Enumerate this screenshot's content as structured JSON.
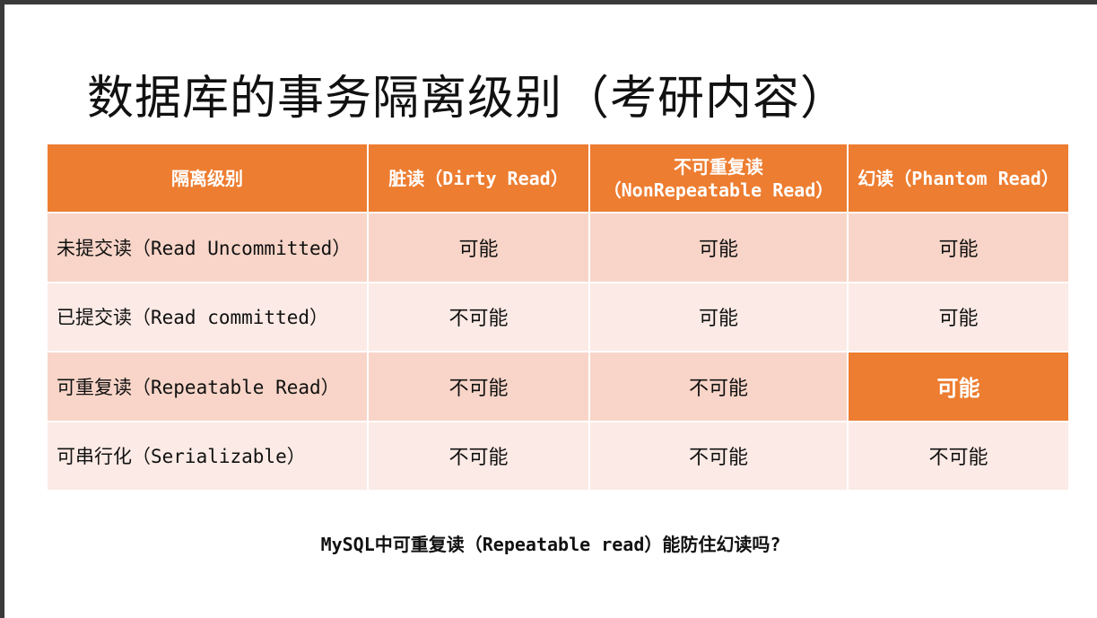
{
  "slide": {
    "title": "数据库的事务隔离级别（考研内容）",
    "footer": "MySQL中可重复读（Repeatable read）能防住幻读吗?"
  },
  "table": {
    "headers": [
      {
        "main": "隔离级别",
        "sub": ""
      },
      {
        "main": "脏读",
        "sub": "（Dirty Read）"
      },
      {
        "main": "不可重复读",
        "sub": "（NonRepeatable Read）"
      },
      {
        "main": "幻读",
        "sub": "（Phantom Read）"
      }
    ],
    "rows": [
      {
        "label_zh": "未提交读",
        "label_en": "（Read Uncommitted）",
        "cells": [
          "可能",
          "可能",
          "可能"
        ]
      },
      {
        "label_zh": "已提交读",
        "label_en": "（Read committed）",
        "cells": [
          "不可能",
          "可能",
          "可能"
        ]
      },
      {
        "label_zh": "可重复读",
        "label_en": "（Repeatable Read）",
        "cells": [
          "不可能",
          "不可能",
          "可能"
        ]
      },
      {
        "label_zh": "可串行化",
        "label_en": "（Serializable）",
        "cells": [
          "不可能",
          "不可能",
          "不可能"
        ]
      }
    ],
    "highlight_color": "#ed7d31"
  }
}
